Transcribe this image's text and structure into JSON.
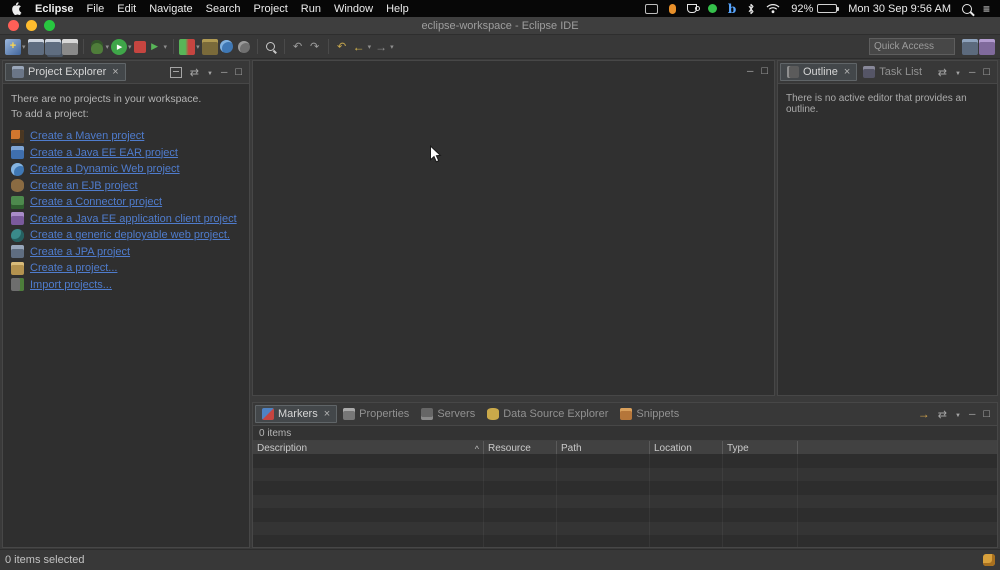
{
  "menubar": {
    "app_name": "Eclipse",
    "items": [
      "File",
      "Edit",
      "Navigate",
      "Search",
      "Project",
      "Run",
      "Window",
      "Help"
    ],
    "status": {
      "battery_percent": "92%",
      "clock": "Mon 30 Sep 9:56 AM"
    },
    "status_icons": [
      "display-icon",
      "mic-icon",
      "coffee-cup-icon",
      "green-status-dot-icon",
      "b-app-icon",
      "bluetooth-icon",
      "wifi-icon",
      "battery-icon",
      "spotlight-search-icon",
      "control-center-icon"
    ]
  },
  "window": {
    "title": "eclipse-workspace - Eclipse IDE"
  },
  "toolbar": {
    "quick_access_placeholder": "Quick Access",
    "icons": [
      "new-wizard",
      "save",
      "save-all",
      "print",
      "debug",
      "run",
      "profile",
      "stop",
      "external-tools",
      "coverage",
      "new-java-project",
      "new-web-project",
      "new-servlet",
      "search",
      "undo",
      "redo",
      "back",
      "forward",
      "last-edit-location",
      "open-perspective",
      "java-ee-perspective"
    ]
  },
  "project_explorer": {
    "tab_label": "Project Explorer",
    "message_line1": "There are no projects in your workspace.",
    "message_line2": "To add a project:",
    "links": [
      {
        "label": "Create a Maven project"
      },
      {
        "label": "Create a Java EE EAR project"
      },
      {
        "label": "Create a Dynamic Web project"
      },
      {
        "label": "Create an EJB project"
      },
      {
        "label": "Create a Connector project"
      },
      {
        "label": "Create a Java EE application client project"
      },
      {
        "label": "Create a generic deployable web project."
      },
      {
        "label": "Create a JPA project"
      },
      {
        "label": "Create a project..."
      },
      {
        "label": "Import projects..."
      }
    ]
  },
  "outline_panel": {
    "outline_tab": "Outline",
    "task_list_tab": "Task List",
    "message": "There is no active editor that provides an outline."
  },
  "bottom_panel": {
    "tabs": [
      {
        "label": "Markers"
      },
      {
        "label": "Properties"
      },
      {
        "label": "Servers"
      },
      {
        "label": "Data Source Explorer"
      },
      {
        "label": "Snippets"
      }
    ],
    "items_count": "0 items",
    "columns": [
      "Description",
      "Resource",
      "Path",
      "Location",
      "Type"
    ],
    "sort_indicator": "^"
  },
  "status_bar": {
    "selection": "0 items selected"
  }
}
